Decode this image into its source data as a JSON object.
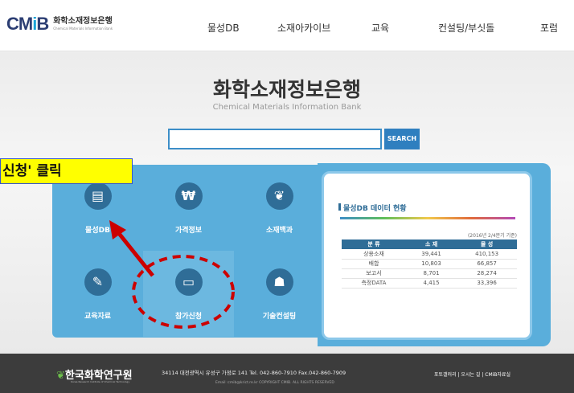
{
  "header": {
    "logo_mark": "CM",
    "logo_i": "i",
    "logo_b": "B",
    "logo_kr": "화학소재정보은행",
    "logo_en": "Chemical Materials Information Bank",
    "nav": [
      "물성DB",
      "소재아카이브",
      "교육",
      "컨설팅/부싯돌",
      "포럼"
    ]
  },
  "hero": {
    "title": "화학소재정보은행",
    "subtitle": "Chemical Materials Information Bank",
    "search_placeholder": "",
    "search_button": "SEARCH"
  },
  "menu": [
    {
      "label": "물성DB",
      "icon": "database-icon"
    },
    {
      "label": "가격정보",
      "icon": "won-icon"
    },
    {
      "label": "소재백과",
      "icon": "book-sprout-icon"
    },
    {
      "label": "교육자료",
      "icon": "notebook-pen-icon"
    },
    {
      "label": "참가신청",
      "icon": "monitor-icon"
    },
    {
      "label": "기술컨설팅",
      "icon": "presentation-icon"
    }
  ],
  "stats": {
    "title": "물성DB 데이터 현황",
    "note": "(2016년 2/4분기 기준)",
    "headers": [
      "분  류",
      "소  재",
      "물  성"
    ],
    "rows": [
      [
        "상용소재",
        "39,441",
        "410,153"
      ],
      [
        "배합",
        "10,803",
        "66,857"
      ],
      [
        "보고서",
        "8,701",
        "28,274"
      ],
      [
        "측정DATA",
        "4,415",
        "33,396"
      ]
    ]
  },
  "footer": {
    "org": "한국화학연구원",
    "org_en": "Korea Research Institute of Chemical Technology",
    "address": "34114 대전광역시 유성구 가정로 141   Tel. 042-860-7910  Fax.042-860-7909",
    "email": "Email :cmib@krict.re.kr COPYRIGHT CMIB. ALL RIGHTS RESERVED",
    "links": "포토갤러리 | 오시는 길 | CMiB자료실"
  },
  "annotation": {
    "callout": "신청' 클릭",
    "arrow_color": "#cc0000",
    "callout_color": "#ffff00"
  }
}
